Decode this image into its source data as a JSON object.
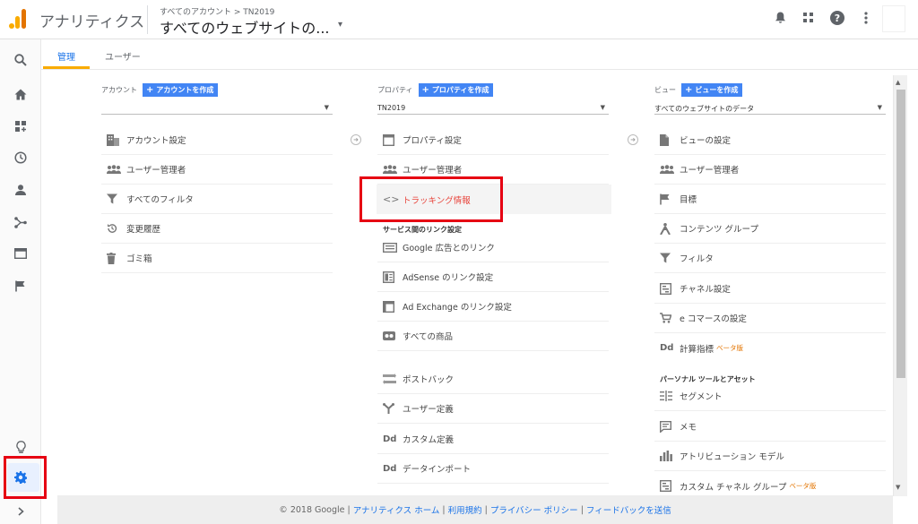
{
  "header": {
    "app_title": "アナリティクス",
    "breadcrumb": "すべてのアカウント > TN2019",
    "view_name": "すべてのウェブサイトの...",
    "caret": "▾"
  },
  "tabs": [
    {
      "label": "管理"
    },
    {
      "label": "ユーザー"
    }
  ],
  "account": {
    "label": "アカウント",
    "create_label": "アカウントを作成",
    "selected": "",
    "items": [
      {
        "label": "アカウント設定"
      },
      {
        "label": "ユーザー管理者"
      },
      {
        "label": "すべてのフィルタ"
      },
      {
        "label": "変更履歴"
      },
      {
        "label": "ゴミ箱"
      }
    ]
  },
  "property": {
    "label": "プロパティ",
    "create_label": "プロパティを作成",
    "selected": "TN2019",
    "items": [
      {
        "label": "プロパティ設定"
      },
      {
        "label": "ユーザー管理者"
      },
      {
        "label": "トラッキング情報"
      }
    ],
    "section_title": "サービス間のリンク設定",
    "link_items": [
      {
        "label": "Google 広告とのリンク"
      },
      {
        "label": "AdSense のリンク設定"
      },
      {
        "label": "Ad Exchange のリンク設定"
      },
      {
        "label": "すべての商品"
      }
    ],
    "more_items": [
      {
        "label": "ポストバック"
      },
      {
        "label": "ユーザー定義"
      },
      {
        "label": "カスタム定義"
      },
      {
        "label": "データインポート"
      }
    ]
  },
  "view": {
    "label": "ビュー",
    "create_label": "ビューを作成",
    "selected": "すべてのウェブサイトのデータ",
    "items": [
      {
        "label": "ビューの設定"
      },
      {
        "label": "ユーザー管理者"
      },
      {
        "label": "目標"
      },
      {
        "label": "コンテンツ グループ"
      },
      {
        "label": "フィルタ"
      },
      {
        "label": "チャネル設定"
      },
      {
        "label": "e コマースの設定"
      },
      {
        "label": "計算指標",
        "badge": "ベータ版"
      }
    ],
    "section_title": "パーソナル ツールとアセット",
    "personal_items": [
      {
        "label": "セグメント"
      },
      {
        "label": "メモ"
      },
      {
        "label": "アトリビューション モデル"
      },
      {
        "label": "カスタム チャネル グループ",
        "badge": "ベータ版"
      }
    ]
  },
  "footer": {
    "copyright": "© 2018 Google",
    "links": [
      "アナリティクス ホーム",
      "利用規約",
      "プライバシー ポリシー",
      "フィードバックを送信"
    ],
    "separator": "|"
  },
  "colors": {
    "accent": "#1a73e8",
    "create_button": "#4285f4",
    "highlight": "#e60012",
    "tab_underline": "#f9ab00",
    "beta": "#e37400"
  }
}
